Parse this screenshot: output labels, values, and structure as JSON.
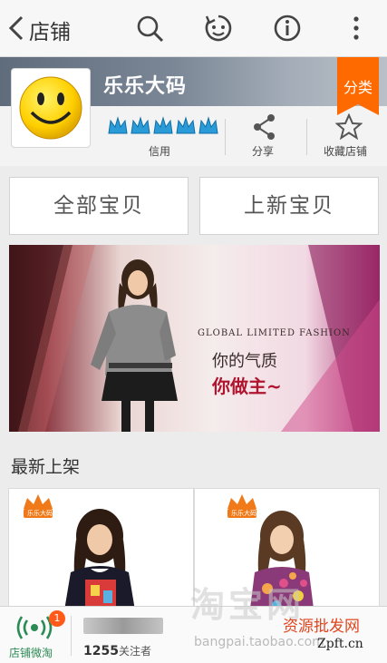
{
  "header": {
    "title": "店铺",
    "icons": [
      "back-icon",
      "search-icon",
      "emoji-icon",
      "info-icon",
      "more-icon"
    ]
  },
  "shop": {
    "name": "乐乐大码",
    "category_tag": "分类",
    "credit_label": "信用",
    "credit_crowns": 5,
    "share_label": "分享",
    "favorite_label": "收藏店铺"
  },
  "tabs": {
    "all_items": "全部宝贝",
    "new_items": "上新宝贝"
  },
  "banner": {
    "english": "GLOBAL LIMITED FASHION",
    "line1": "你的气质",
    "line2": "你做主~"
  },
  "section": {
    "latest_title": "最新上架"
  },
  "products": [
    {
      "logo_text": "乐乐大码"
    },
    {
      "logo_text": "乐乐大码"
    }
  ],
  "bottom": {
    "weitao_label": "店铺微淘",
    "badge_count": "1",
    "fans_count": "1255",
    "fans_suffix": "关注者"
  },
  "watermark": {
    "big": "淘宝网",
    "url": "bangpai.taobao.com",
    "site_cn": "资源批发网",
    "site_en": "Zpft.cn"
  },
  "colors": {
    "accent_orange": "#ff6a00",
    "credit_blue": "#2a9bd6",
    "weitao_green": "#2b8a55"
  }
}
